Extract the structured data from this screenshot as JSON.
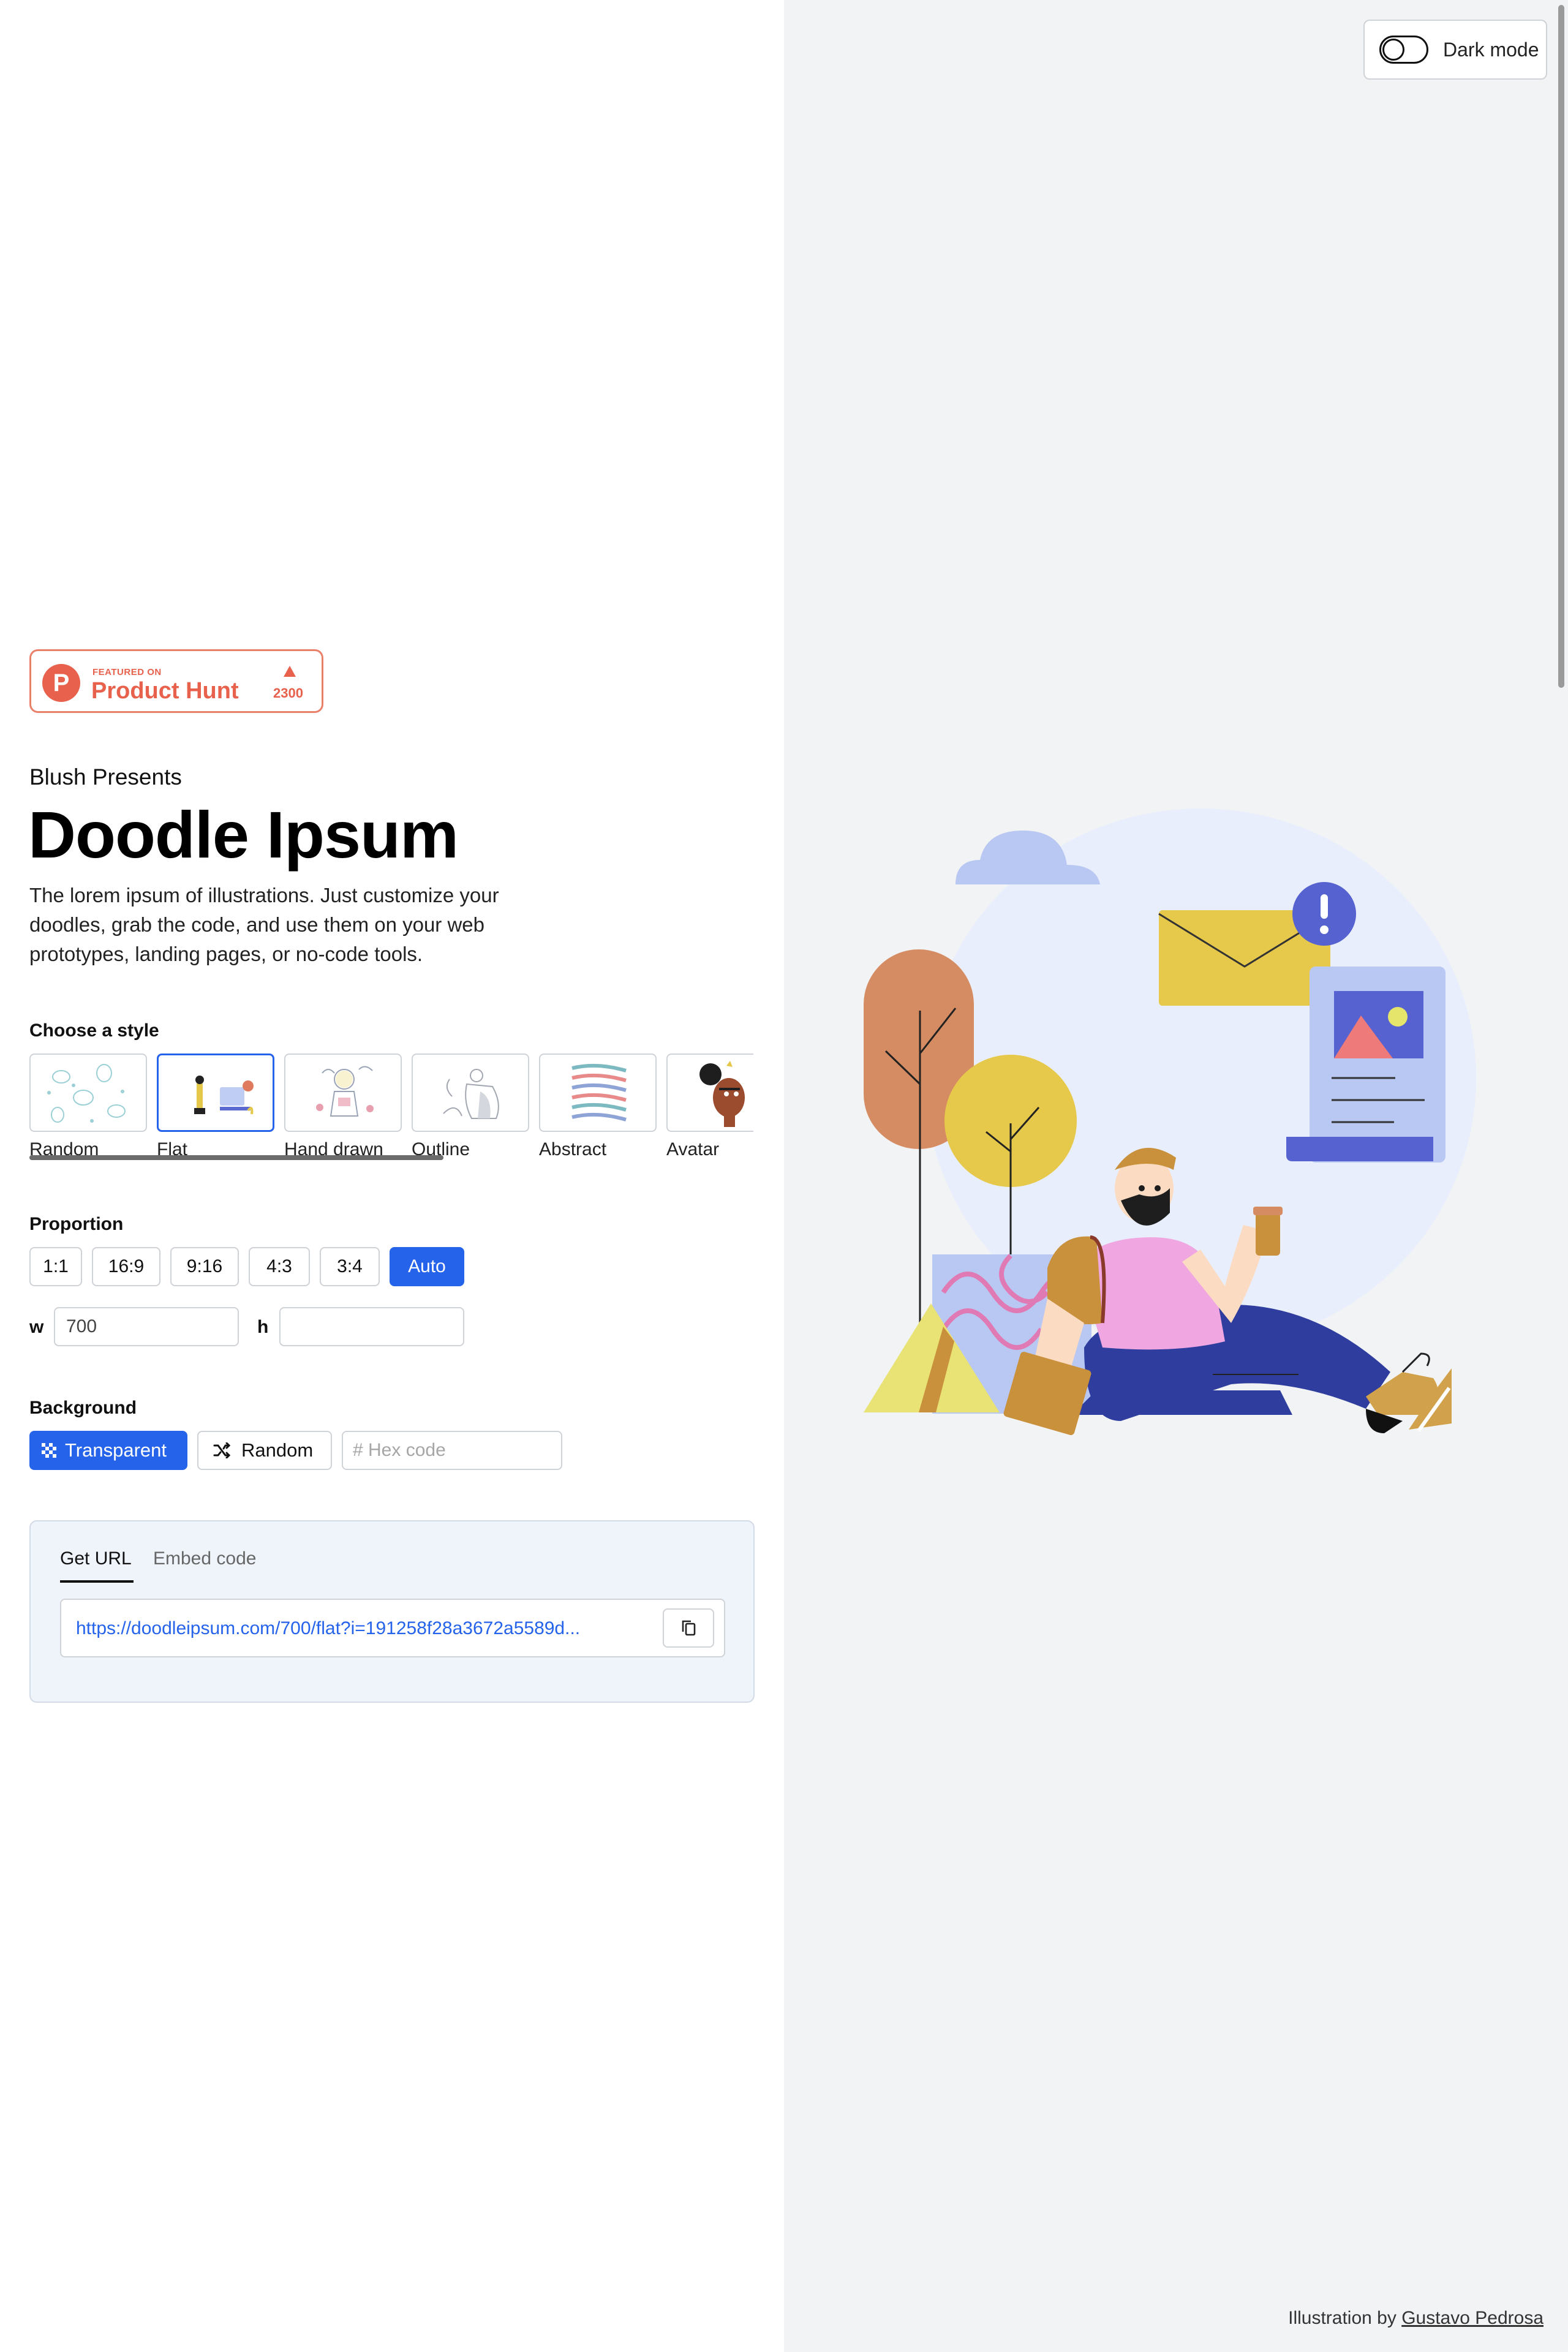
{
  "header": {
    "dark_mode_label": "Dark mode"
  },
  "badge": {
    "featured": "FEATURED ON",
    "name": "Product Hunt",
    "logo_letter": "P",
    "count": "2300",
    "color": "#e8614c"
  },
  "hero": {
    "presenter": "Blush Presents",
    "title": "Doodle Ipsum",
    "description": "The lorem ipsum of illustrations. Just customize your doodles, grab the code, and use them on your web prototypes, landing pages, or no-code tools."
  },
  "style": {
    "label": "Choose a style",
    "options": [
      {
        "label": "Random",
        "selected": false
      },
      {
        "label": "Flat",
        "selected": true
      },
      {
        "label": "Hand drawn",
        "selected": false
      },
      {
        "label": "Outline",
        "selected": false
      },
      {
        "label": "Abstract",
        "selected": false
      },
      {
        "label": "Avatar",
        "selected": false
      }
    ]
  },
  "proportion": {
    "label": "Proportion",
    "options": [
      "1:1",
      "16:9",
      "9:16",
      "4:3",
      "3:4",
      "Auto"
    ],
    "active": "Auto",
    "w_label": "w",
    "w_value": "700",
    "h_label": "h",
    "h_value": ""
  },
  "background": {
    "label": "Background",
    "transparent_label": "Transparent",
    "random_label": "Random",
    "hex_placeholder": "# Hex code"
  },
  "output": {
    "tabs": [
      "Get URL",
      "Embed code"
    ],
    "active_tab": "Get URL",
    "url": "https://doodleipsum.com/700/flat?i=191258f28a3672a5589d..."
  },
  "credit": {
    "prefix": "Illustration by",
    "author": "Gustavo Pedrosa"
  },
  "colors": {
    "accent": "#2563eb",
    "right_panel_bg": "#f2f3f5"
  }
}
